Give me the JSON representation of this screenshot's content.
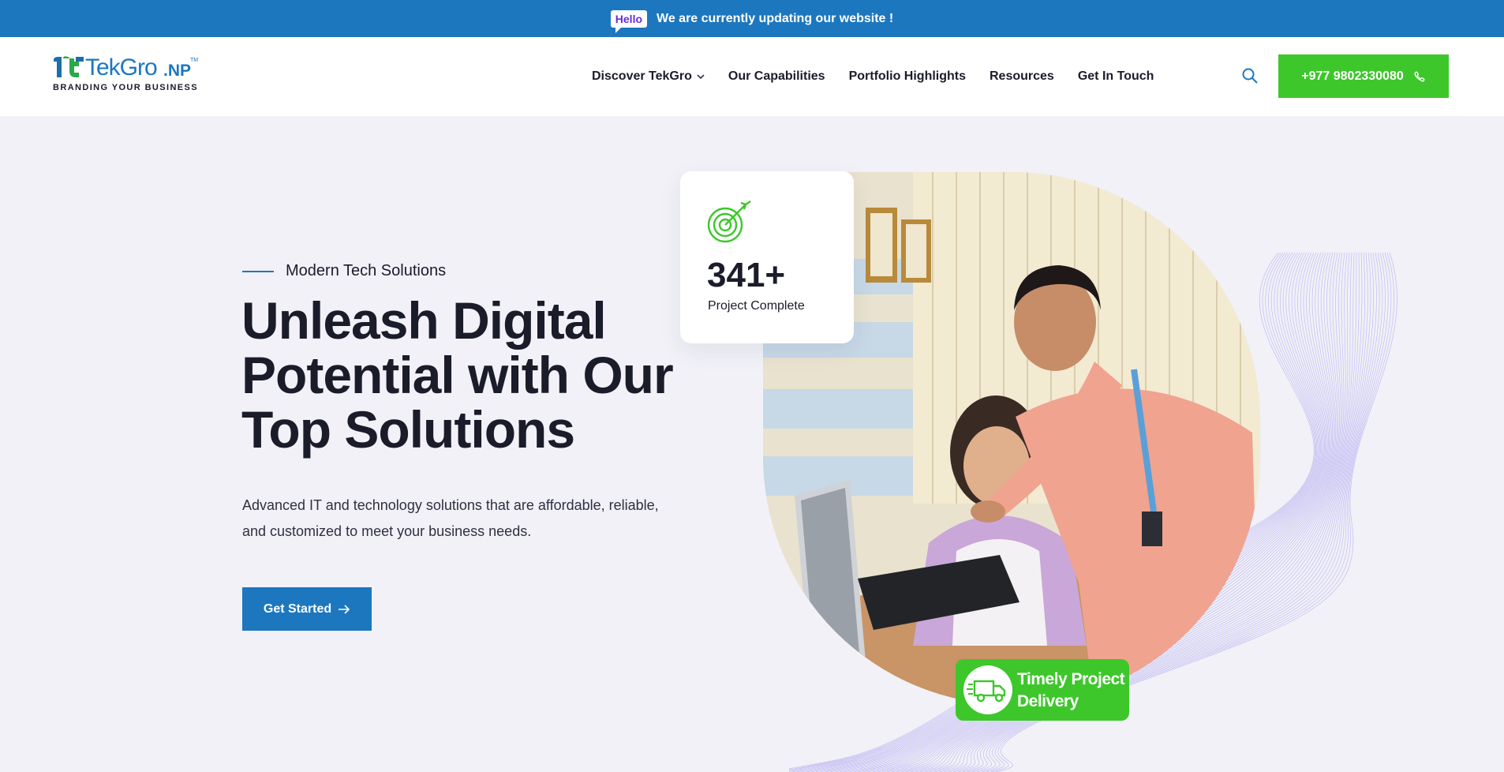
{
  "announcement": {
    "badge": "Hello",
    "text": "We are currently updating our website !"
  },
  "header": {
    "logo": {
      "word": "TekGro",
      "suffix": ".NP",
      "trademark": "TM",
      "tagline": "BRANDING YOUR BUSINESS"
    },
    "nav": [
      {
        "label": "Discover TekGro",
        "has_dropdown": true
      },
      {
        "label": "Our Capabilities"
      },
      {
        "label": "Portfolio Highlights"
      },
      {
        "label": "Resources"
      },
      {
        "label": "Get In Touch"
      }
    ],
    "search_icon": "search-icon",
    "phone_label": "+977 9802330080",
    "phone_icon": "phone-icon"
  },
  "hero": {
    "tagline": "Modern Tech Solutions",
    "title": "Unleash Digital Potential with Our Top Solutions",
    "description": "Advanced IT and technology solutions that are affordable, reliable, and customized to meet your business needs.",
    "cta_label": "Get Started",
    "cta_icon": "arrow-right-icon"
  },
  "stat_card": {
    "icon": "target-icon",
    "value": "341+",
    "label": "Project Complete"
  },
  "delivery_badge": {
    "icon": "delivery-truck-icon",
    "line1": "Timely Project",
    "line2": "Delivery"
  },
  "colors": {
    "primary": "#1c77bf",
    "accent_green": "#3dc72b",
    "background": "#f1f1f7",
    "text_dark": "#1b1c2a",
    "wave_purple": "#9b8ff0"
  }
}
